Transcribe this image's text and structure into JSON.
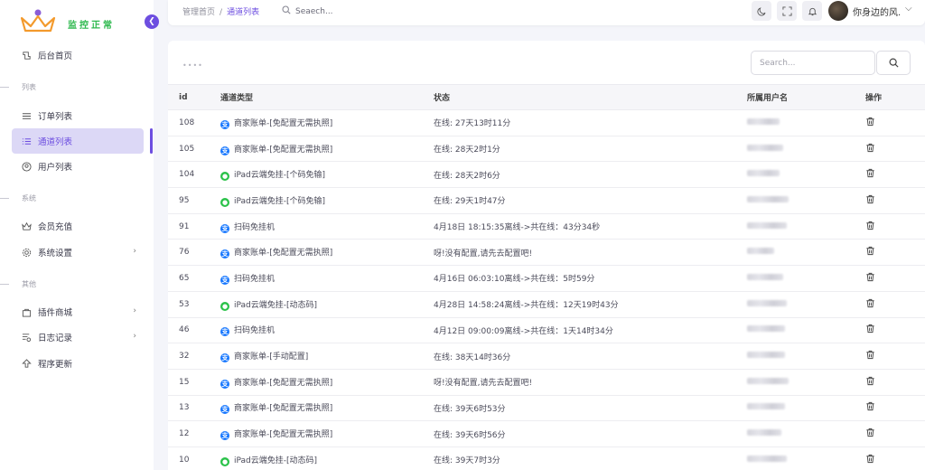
{
  "logo": {
    "text": "监控正常"
  },
  "sidebar": {
    "items": [
      {
        "label": "后台首页",
        "icon": "home-icon",
        "active": false,
        "chevron": false
      },
      {
        "section": "列表"
      },
      {
        "label": "订单列表",
        "icon": "list-icon",
        "active": false,
        "chevron": false
      },
      {
        "label": "通道列表",
        "icon": "channel-list-icon",
        "active": true,
        "chevron": false
      },
      {
        "label": "用户列表",
        "icon": "user-icon",
        "active": false,
        "chevron": false
      },
      {
        "section": "系统"
      },
      {
        "label": "会员充值",
        "icon": "crown-icon",
        "active": false,
        "chevron": false
      },
      {
        "label": "系统设置",
        "icon": "gear-icon",
        "active": false,
        "chevron": true
      },
      {
        "section": "其他"
      },
      {
        "label": "插件商城",
        "icon": "bag-icon",
        "active": false,
        "chevron": true
      },
      {
        "label": "日志记录",
        "icon": "log-icon",
        "active": false,
        "chevron": true
      },
      {
        "label": "程序更新",
        "icon": "upload-icon",
        "active": false,
        "chevron": false
      }
    ]
  },
  "header": {
    "breadcrumb": [
      "管理首页",
      "通道列表"
    ],
    "breadcrumb_sep": "/",
    "search_placeholder": "Seaech...",
    "username": "你身边的风."
  },
  "table": {
    "dots": "••••",
    "search_placeholder": "Search...",
    "columns": [
      "id",
      "通道类型",
      "状态",
      "所属用户名",
      "操作"
    ],
    "rows": [
      {
        "id": "108",
        "kind": "alipay",
        "type": "商家账单-[免配置无需执照]",
        "status": "在线: 27天13时11分"
      },
      {
        "id": "105",
        "kind": "alipay",
        "type": "商家账单-[免配置无需执照]",
        "status": "在线: 28天2时1分"
      },
      {
        "id": "104",
        "kind": "wechat",
        "type": "iPad云端免挂-[个码免输]",
        "status": "在线: 28天2时6分"
      },
      {
        "id": "95",
        "kind": "wechat",
        "type": "iPad云端免挂-[个码免输]",
        "status": "在线: 29天1时47分"
      },
      {
        "id": "91",
        "kind": "alipay",
        "type": "扫码免挂机",
        "status": "4月18日 18:15:35离线->共在线：43分34秒"
      },
      {
        "id": "76",
        "kind": "alipay",
        "type": "商家账单-[免配置无需执照]",
        "status": "呀!没有配置,请先去配置吧!"
      },
      {
        "id": "65",
        "kind": "alipay",
        "type": "扫码免挂机",
        "status": "4月16日 06:03:10离线->共在线：5时59分"
      },
      {
        "id": "53",
        "kind": "wechat",
        "type": "iPad云端免挂-[动态码]",
        "status": "4月28日 14:58:24离线->共在线：12天19时43分"
      },
      {
        "id": "46",
        "kind": "alipay",
        "type": "扫码免挂机",
        "status": "4月12日 09:00:09离线->共在线：1天14时34分"
      },
      {
        "id": "32",
        "kind": "alipay",
        "type": "商家账单-[手动配置]",
        "status": "在线: 38天14时36分"
      },
      {
        "id": "15",
        "kind": "alipay",
        "type": "商家账单-[免配置无需执照]",
        "status": "呀!没有配置,请先去配置吧!"
      },
      {
        "id": "13",
        "kind": "alipay",
        "type": "商家账单-[免配置无需执照]",
        "status": "在线: 39天6时53分"
      },
      {
        "id": "12",
        "kind": "alipay",
        "type": "商家账单-[免配置无需执照]",
        "status": "在线: 39天6时56分"
      },
      {
        "id": "10",
        "kind": "wechat",
        "type": "iPad云端免挂-[动态码]",
        "status": "在线: 39天7时3分"
      }
    ]
  },
  "colors": {
    "accent": "#6d4ee0",
    "alipay": "#1677ff",
    "wechat": "#2ac249",
    "logo_text": "#2db84d"
  }
}
